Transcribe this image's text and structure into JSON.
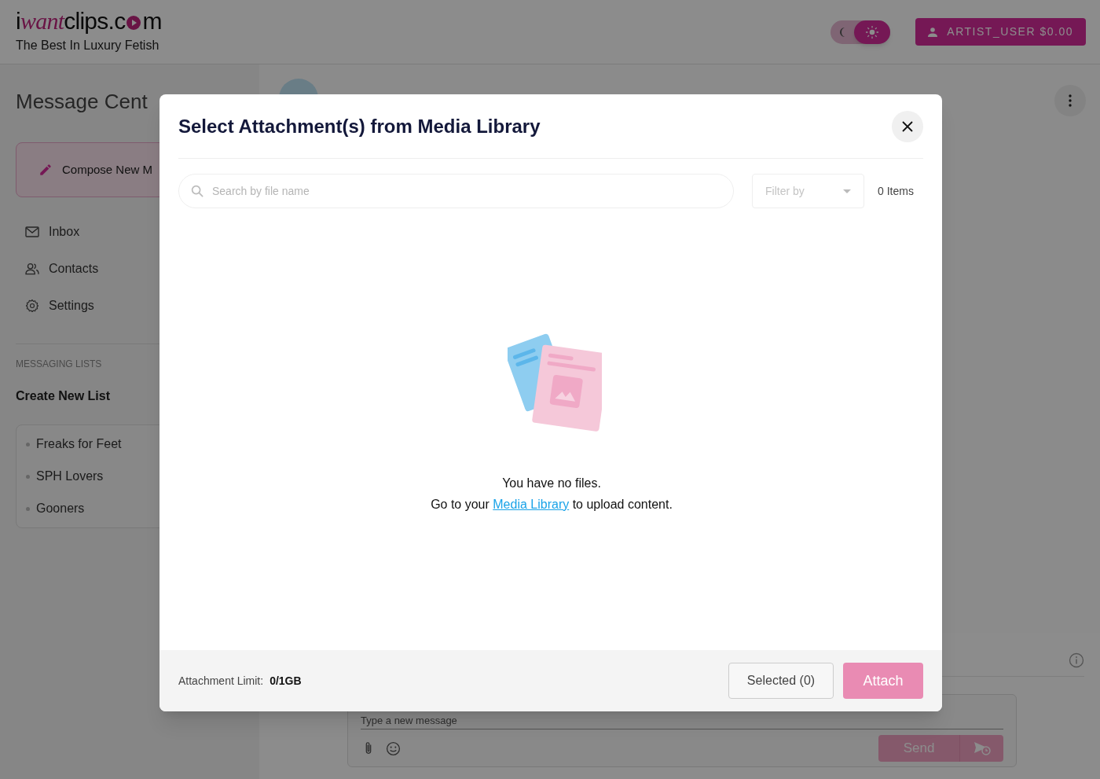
{
  "header": {
    "logo": {
      "parts": [
        {
          "kind": "plain",
          "text": "i"
        },
        {
          "kind": "accent",
          "text": "want"
        },
        {
          "kind": "plain",
          "text": "clips.c"
        },
        {
          "kind": "play"
        },
        {
          "kind": "plain",
          "text": "m"
        }
      ]
    },
    "tagline": "The Best In Luxury Fetish",
    "theme_toggle": [
      {
        "kind": "dark",
        "selected": false
      },
      {
        "kind": "light",
        "selected": true
      }
    ],
    "account_button": "ARTIST_USER $0.00"
  },
  "sidebar": {
    "title": "Message Cent",
    "compose_button": "Compose New M",
    "items": [
      {
        "kind": "inbox",
        "label": "Inbox"
      },
      {
        "kind": "contacts",
        "label": "Contacts"
      },
      {
        "kind": "settings",
        "label": "Settings"
      }
    ],
    "section_label": "MESSAGING LISTS",
    "create_list": "Create New List",
    "lists": [
      {
        "label": "Freaks for Feet"
      },
      {
        "label": "SPH Lovers"
      },
      {
        "label": "Gooners"
      }
    ]
  },
  "composer": {
    "placeholder": "Type a new message",
    "send_button": "Send"
  },
  "dialog": {
    "title": "Select Attachment(s) from Media Library",
    "search": {
      "placeholder": "Search by file name"
    },
    "filter": {
      "placeholder": "Filter by"
    },
    "item_count": "0 Items",
    "empty": {
      "heading": "You have no files.",
      "before": "Go to your ",
      "link": "Media Library",
      "after": " to upload content."
    },
    "footer": {
      "limit_label": "Attachment Limit:",
      "limit_value": "0/1GB",
      "selected_button": "Selected (0)",
      "attach_button": "Attach",
      "attach_disabled": true
    }
  }
}
